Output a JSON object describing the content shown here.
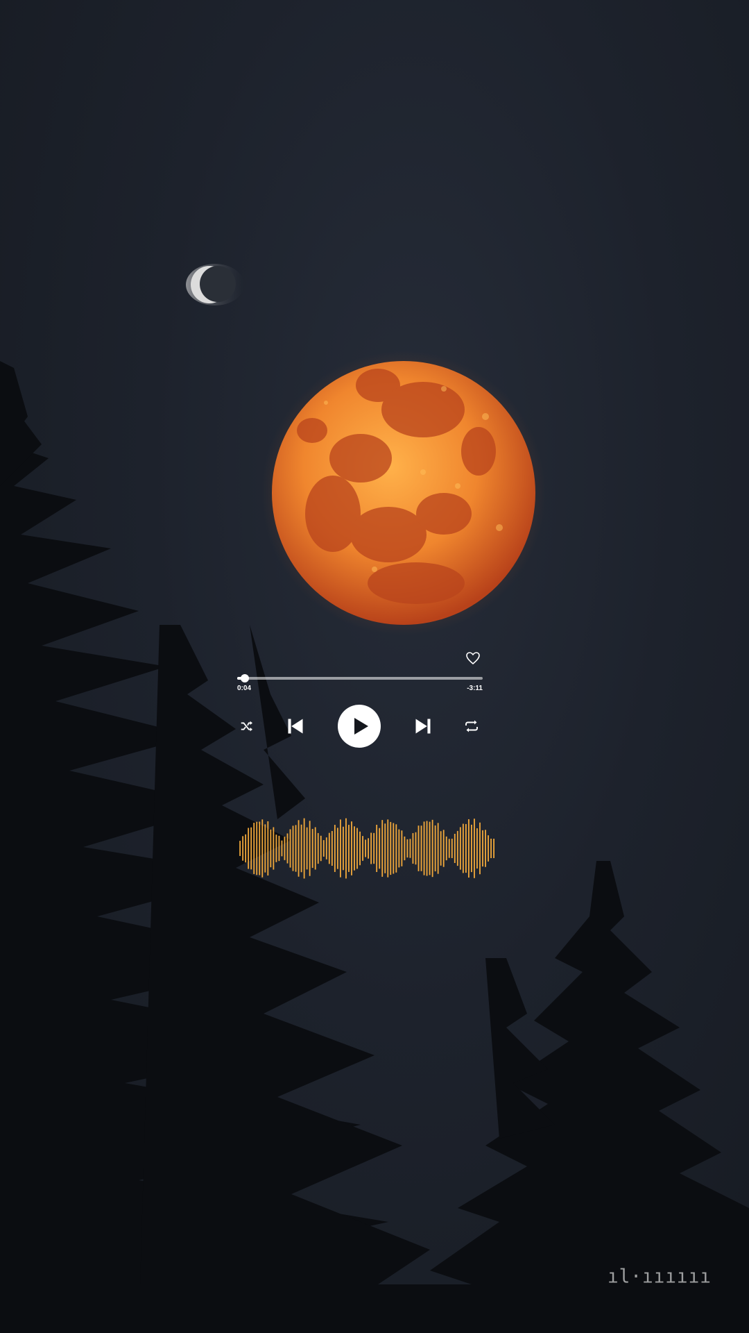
{
  "player": {
    "liked": false,
    "elapsed": "0:04",
    "remaining": "-3:11",
    "progress_fraction": 0.03,
    "state": "paused"
  },
  "icons": {
    "like": "heart-outline-icon",
    "shuffle": "shuffle-icon",
    "previous": "skip-previous-icon",
    "play": "play-icon",
    "next": "skip-next-icon",
    "repeat": "repeat-icon"
  },
  "colors": {
    "accent_waveform": "#f2a93b",
    "moon": "#e8772a",
    "controls": "#ffffff",
    "sky": "#1d222c"
  },
  "watermark": {
    "text": "ıl·ıııııı"
  }
}
